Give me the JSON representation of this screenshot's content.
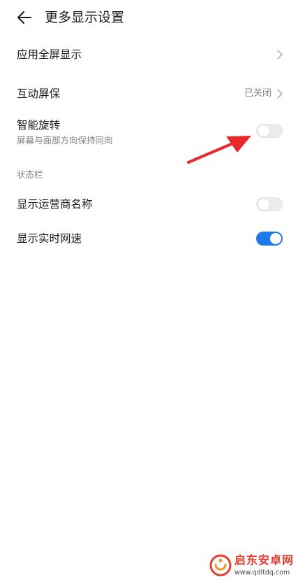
{
  "header": {
    "back_icon": "arrow-left-icon",
    "title": "更多显示设置"
  },
  "items": [
    {
      "title": "应用全屏显示",
      "value": "",
      "control": "chevron"
    },
    {
      "title": "互动屏保",
      "value": "已关闭",
      "control": "chevron"
    },
    {
      "title": "智能旋转",
      "subtitle": "屏幕与面部方向保持同向",
      "control": "switch",
      "on": false
    }
  ],
  "section": {
    "label": "状态栏",
    "items": [
      {
        "title": "显示运营商名称",
        "control": "switch",
        "on": false
      },
      {
        "title": "显示实时网速",
        "control": "switch",
        "on": true
      }
    ]
  },
  "annotation": {
    "icon": "red-arrow-icon",
    "color": "#e8282b"
  },
  "watermark": {
    "name": "启东安卓网",
    "url": "www.qdltdq.com",
    "icon": "watermark-logo-icon"
  },
  "colors": {
    "accent": "#1f7aeb",
    "switch_off": "#ececec",
    "secondary_text": "#808080"
  }
}
